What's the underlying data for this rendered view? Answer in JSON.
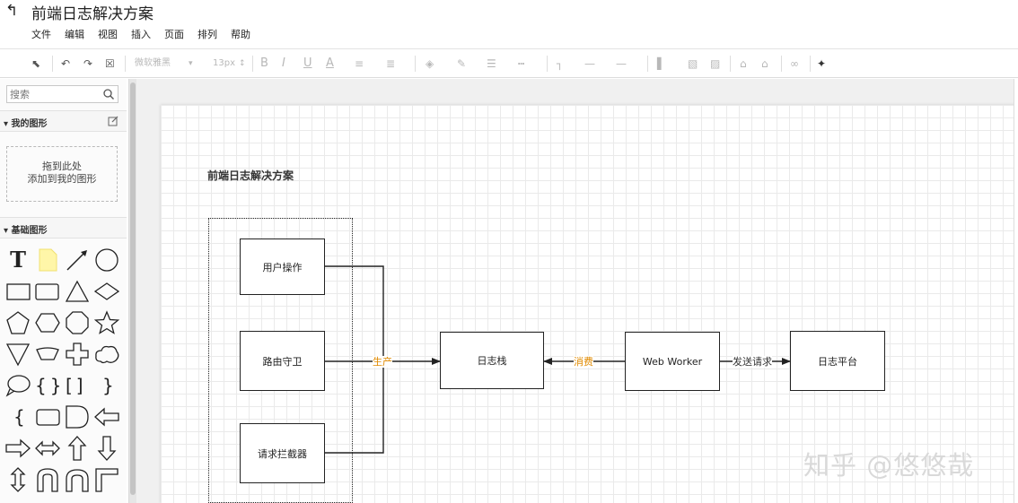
{
  "app": {
    "title": "前端日志解决方案"
  },
  "menu": [
    "文件",
    "编辑",
    "视图",
    "插入",
    "页面",
    "排列",
    "帮助"
  ],
  "toolbar": {
    "font_family": "微软雅黑",
    "font_size": "13px"
  },
  "sidebar": {
    "search_placeholder": "搜索",
    "my_shapes": "我的图形",
    "drop_line1": "拖到此处",
    "drop_line2": "添加到我的图形",
    "basic_shapes": "基础图形"
  },
  "diagram": {
    "title": "前端日志解决方案",
    "nodes": {
      "user_action": "用户操作",
      "route_guard": "路由守卫",
      "interceptor": "请求拦截器",
      "log_stack": "日志栈",
      "web_worker": "Web Worker",
      "log_platform": "日志平台"
    },
    "edges": {
      "produce": "生产",
      "consume": "消费",
      "send_request": "发送请求"
    },
    "colors": {
      "accent_label": "#e08a00",
      "stroke": "#222222"
    }
  },
  "watermark": "知乎 @悠悠哉"
}
